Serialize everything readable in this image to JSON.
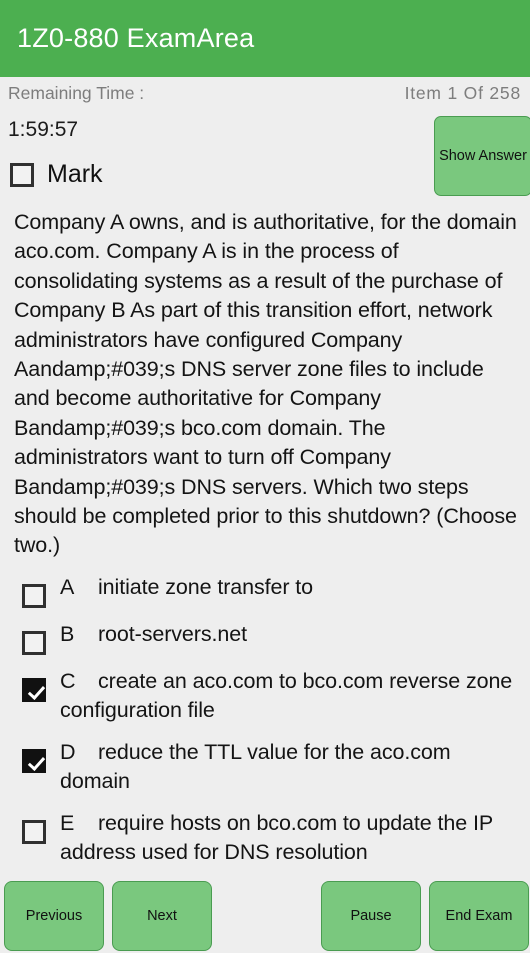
{
  "titlebar": {
    "title": "1Z0-880 ExamArea"
  },
  "status": {
    "remaining_time_label": "Remaining Time :",
    "item_counter": "Item 1 Of 258",
    "timer_value": "1:59:57"
  },
  "mark": {
    "label": "Mark",
    "checked": false
  },
  "show_answer": {
    "label": "Show Answer"
  },
  "question": {
    "text": "Company A owns, and is authoritative, for the domain aco.com. Company A is in the process of consolidating systems as a result of the purchase of Company B As part of this transition effort, network administrators have configured Company Aandamp;#039;s DNS server zone files to include and become authoritative for Company Bandamp;#039;s bco.com domain. The administrators want to turn off Company Bandamp;#039;s DNS servers. Which two steps should be completed prior to this shutdown? (Choose two.)"
  },
  "options": [
    {
      "letter": "A",
      "text": "initiate zone transfer to",
      "checked": false
    },
    {
      "letter": "B",
      "text": "root-servers.net",
      "checked": false
    },
    {
      "letter": "C",
      "text": "create an aco.com to bco.com reverse zone configuration file",
      "checked": true
    },
    {
      "letter": "D",
      "text": "reduce the TTL value for the aco.com domain",
      "checked": true
    },
    {
      "letter": "E",
      "text": "require hosts on bco.com to update the IP address used for DNS resolution",
      "checked": false
    }
  ],
  "buttons": {
    "previous": "Previous",
    "next": "Next",
    "pause": "Pause",
    "end_exam": "End Exam"
  },
  "colors": {
    "titlebar_green": "#4caf50",
    "button_green": "#7ac87e",
    "button_border_green": "#4a9c51",
    "page_background": "#eeeeee",
    "muted_text": "#7d7d7d"
  }
}
